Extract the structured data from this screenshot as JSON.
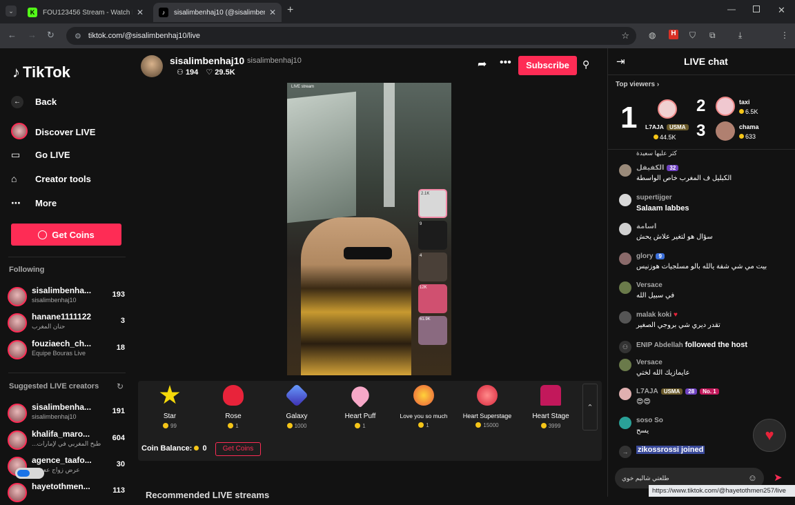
{
  "browser": {
    "tabs": [
      {
        "title": "FOU123456 Stream - Watch Liv",
        "active": false
      },
      {
        "title": "sisalimbenhaj10 (@sisalimbenh",
        "active": true
      }
    ],
    "new_tab": "+",
    "url": "tiktok.com/@sisalimbenhaj10/live",
    "status_url": "https://www.tiktok.com/@hayetothmen257/live",
    "profile_initial": "F"
  },
  "sidebar": {
    "logo": "TikTok",
    "nav": [
      {
        "label": "Back",
        "icon": "back-arrow-icon"
      },
      {
        "label": "Discover LIVE",
        "icon": "discover-live-icon"
      },
      {
        "label": "Go LIVE",
        "icon": "video-camera-icon"
      },
      {
        "label": "Creator tools",
        "icon": "home-icon"
      },
      {
        "label": "More",
        "icon": "more-dots-icon"
      }
    ],
    "get_coins": "Get Coins",
    "following_title": "Following",
    "following": [
      {
        "name": "sisalimbenha...",
        "sub": "sisalimbenhaj10",
        "count": "193"
      },
      {
        "name": "hanane1111122",
        "sub": "حنان المغرب",
        "count": "3"
      },
      {
        "name": "fouziaech_ch...",
        "sub": "Equipe Bouras Live",
        "count": "18"
      }
    ],
    "suggested_title": "Suggested LIVE creators",
    "suggested": [
      {
        "name": "sisalimbenha...",
        "sub": "sisalimbenhaj10",
        "count": "191"
      },
      {
        "name": "khalifa_maro...",
        "sub": "...ر طبخ المغربي في لإمارات",
        "count": "604"
      },
      {
        "name": "agence_taafo...",
        "sub": "...عرض زواج ععقد",
        "count": "30"
      },
      {
        "name": "hayetothmen...",
        "sub": "",
        "count": "113"
      }
    ]
  },
  "stream": {
    "host_name": "sisalimbenhaj10",
    "host_handle": "sisalimbenhaj10",
    "viewers": "194",
    "likes": "29.5K",
    "subscribe": "Subscribe",
    "video_label": "LIVE stream",
    "side_viewers": [
      "2.1K",
      "9",
      "4",
      "12K",
      "61.9K"
    ],
    "gifts": [
      {
        "name": "Star",
        "price": "99",
        "color": "#f5d90a"
      },
      {
        "name": "Rose",
        "price": "1",
        "color": "#e8233a"
      },
      {
        "name": "Galaxy",
        "price": "1000",
        "color": "#3b5bdb"
      },
      {
        "name": "Heart Puff",
        "price": "1",
        "color": "#f7a8c8"
      },
      {
        "name": "Love you so much",
        "price": "1",
        "color": "#e85a3c"
      },
      {
        "name": "Heart Superstage",
        "price": "15000",
        "color": "#d9263c"
      },
      {
        "name": "Heart Stage",
        "price": "3999",
        "color": "#c2185b"
      }
    ],
    "coin_balance_label": "Coin Balance:",
    "coin_balance": "0",
    "get_coins": "Get Coins",
    "recommended": "Recommended LIVE streams"
  },
  "chat": {
    "title": "LIVE chat",
    "top_viewers": "Top viewers",
    "ranking": [
      {
        "rank": "1",
        "name": "L7AJA",
        "badge": "USMA",
        "coins": "44.5K"
      },
      {
        "rank": "2",
        "name": "taxi",
        "coins": "6.5K"
      },
      {
        "rank": "3",
        "name": "chama",
        "coins": "633"
      }
    ],
    "partial_top": "كثر عليها سعيدة",
    "messages": [
      {
        "user": "الكفيفل",
        "badge": "32",
        "text": "الكبليل ف المغرب خاص الواسطة",
        "av": "#9a8a7a"
      },
      {
        "user": "supertijger",
        "badge": "",
        "text": "Salaam labbes",
        "av": "#d8d8d8"
      },
      {
        "user": "اسامة",
        "badge": "",
        "text": "سؤال هو لتغير علاش يحش",
        "av": "#cfcfcf"
      },
      {
        "user": "glory",
        "badge": "9",
        "text": "بيت مي شي شفة يالله بالو مسلجيات هوزنيس",
        "av": "#8a6a6a"
      },
      {
        "user": "Versace",
        "badge": "",
        "text": "في سبيل الله",
        "av": "#6a7a4a"
      },
      {
        "user": "malak koki",
        "badge": "",
        "text": "تقدر ديري شي بروجي الصغير",
        "av": "#555"
      },
      {
        "user": "Versace",
        "badge": "",
        "text": "عايمازيك الله لختي",
        "av": "#6a7a4a"
      },
      {
        "user": "L7AJA",
        "badge": "28",
        "text": "😍😍",
        "av": "#e0b0b0"
      },
      {
        "user": "soso So",
        "badge": "",
        "text": "يسح",
        "av": "#2aa198"
      }
    ],
    "follow_event_user": "ENIP Abdellah",
    "follow_event_text": "followed the host",
    "joined": "zikossrossi joined",
    "input_text": "طلعتي شاليم خوي",
    "no1": "No. 1",
    "usma": "USMA"
  }
}
